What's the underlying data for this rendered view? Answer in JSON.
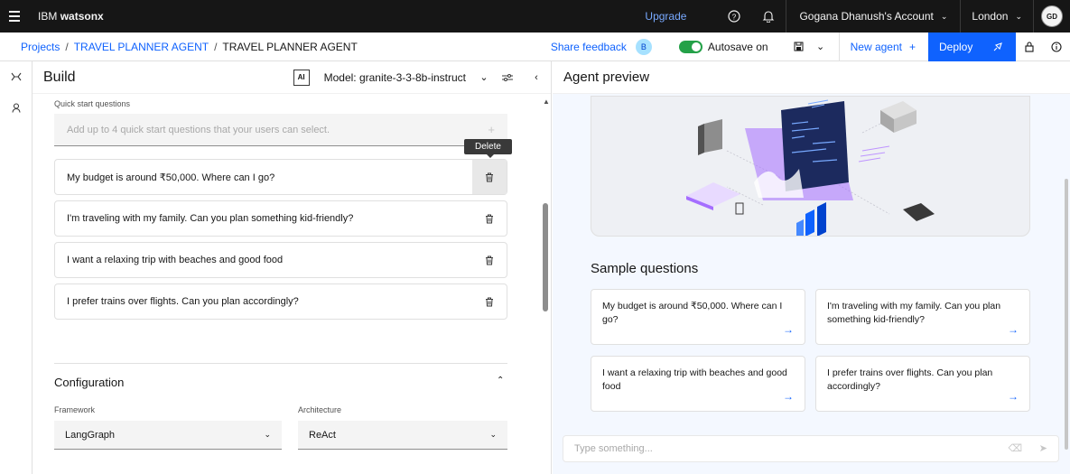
{
  "topbar": {
    "brand_prefix": "IBM",
    "brand_product": "watsonx",
    "upgrade": "Upgrade",
    "account": "Gogana Dhanush's Account",
    "region": "London",
    "avatar": "GD"
  },
  "subbar": {
    "breadcrumbs": [
      "Projects",
      "TRAVEL PLANNER AGENT",
      "TRAVEL PLANNER AGENT"
    ],
    "share_feedback": "Share feedback",
    "feedback_badge": "B",
    "autosave": "Autosave on",
    "new_agent": "New agent",
    "deploy": "Deploy"
  },
  "build": {
    "title": "Build",
    "ai_badge": "AI",
    "model": "Model: granite-3-3-8b-instruct",
    "quick_start_label": "Quick start questions",
    "add_placeholder": "Add up to 4 quick start questions that your users can select.",
    "tooltip": "Delete",
    "questions": [
      "My budget is around ₹50,000. Where can I go?",
      "I'm traveling with my family. Can you plan something kid-friendly?",
      "I want a relaxing trip with beaches and good food",
      "I prefer trains over flights. Can you plan accordingly?"
    ],
    "configuration_title": "Configuration",
    "framework_label": "Framework",
    "framework_value": "LangGraph",
    "architecture_label": "Architecture",
    "architecture_value": "ReAct"
  },
  "preview": {
    "title": "Agent preview",
    "sample_title": "Sample questions",
    "samples": [
      "My budget is around ₹50,000. Where can I go?",
      "I'm traveling with my family. Can you plan something kid-friendly?",
      "I want a relaxing trip with beaches and good food",
      "I prefer trains over flights. Can you plan accordingly?"
    ],
    "chat_placeholder": "Type something..."
  },
  "colors": {
    "accent": "#0f62fe",
    "topbar": "#161616",
    "toggle_on": "#24a148"
  }
}
